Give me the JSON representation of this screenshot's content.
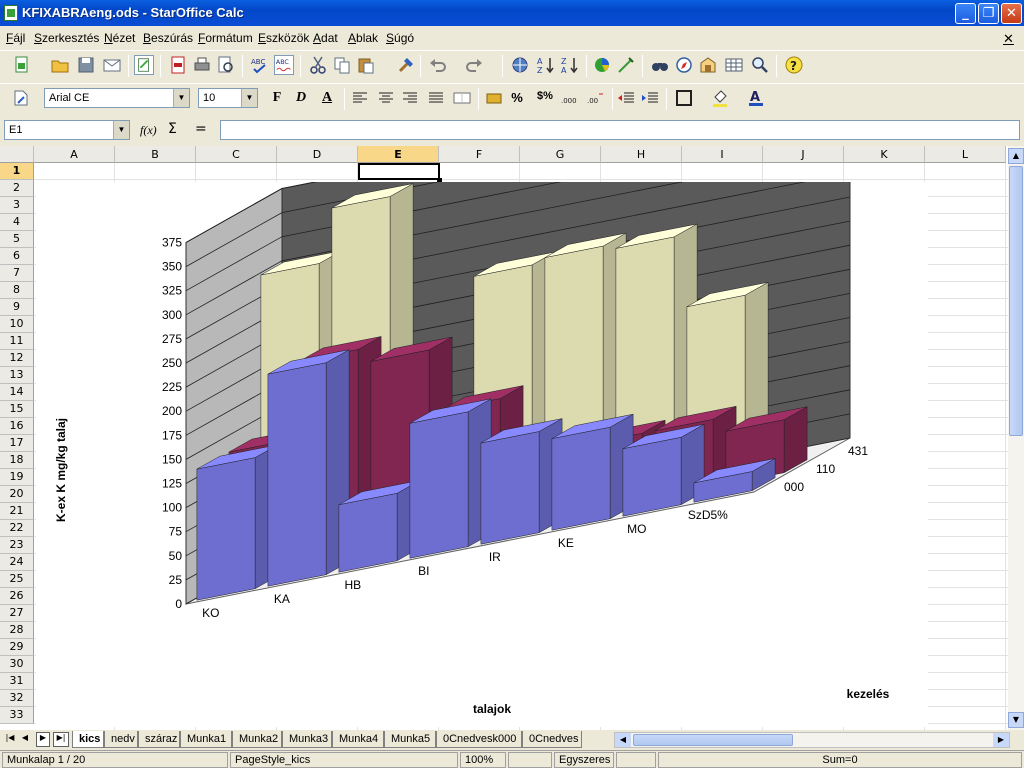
{
  "window": {
    "title": "KFIXABRAeng.ods - StarOffice Calc",
    "min_label": "_",
    "max_label": "❐",
    "close_label": "✕"
  },
  "menus": [
    "Fájl",
    "Szerkesztés",
    "Nézet",
    "Beszúrás",
    "Formátum",
    "Eszközök",
    "Adat",
    "Ablak",
    "Súgó"
  ],
  "menu_close": "✕",
  "format": {
    "font_name": "Arial CE",
    "font_size": "10",
    "bold": "F",
    "italic": "D",
    "underline": "A",
    "percent": "%",
    "currency": "$%"
  },
  "formula_bar": {
    "cell_ref": "E1",
    "fx": "f(x)",
    "sum": "Σ",
    "equals": "=",
    "content": ""
  },
  "columns": [
    "A",
    "B",
    "C",
    "D",
    "E",
    "F",
    "G",
    "H",
    "I",
    "J",
    "K",
    "L"
  ],
  "rows": [
    "1",
    "2",
    "3",
    "4",
    "5",
    "6",
    "7",
    "8",
    "9",
    "10",
    "11",
    "12",
    "13",
    "14",
    "15",
    "16",
    "17",
    "18",
    "19",
    "20",
    "21",
    "22",
    "23",
    "24",
    "25",
    "26",
    "27",
    "28",
    "29",
    "30",
    "31",
    "32",
    "33"
  ],
  "sheet_tabs": [
    "kics",
    "nedv",
    "száraz",
    "Munka1",
    "Munka2",
    "Munka3",
    "Munka4",
    "Munka5",
    "0Cnedvesk000",
    "0Cnedves"
  ],
  "status": {
    "page": "Munkalap 1 / 20",
    "style": "PageStyle_kics",
    "zoom": "100%",
    "mode": "Egyszeres",
    "sum": "Sum=0"
  },
  "chart_data": {
    "type": "bar",
    "subtype": "3d-deep",
    "categories": [
      "KO",
      "KA",
      "HB",
      "BI",
      "IR",
      "KE",
      "MO",
      "SzD5%"
    ],
    "series": [
      {
        "name": "000",
        "values": [
          136,
          220,
          70,
          140,
          105,
          95,
          70,
          20
        ],
        "color": "#7a7ae8"
      },
      {
        "name": "110",
        "values": [
          135,
          215,
          200,
          135,
          75,
          70,
          70,
          55
        ],
        "color": "#8e2a5a"
      },
      {
        "name": "431",
        "values": [
          300,
          355,
          110,
          255,
          260,
          255,
          180,
          0
        ],
        "color": "#f4f2c2"
      }
    ],
    "yticks": [
      "0",
      "25",
      "50",
      "75",
      "100",
      "125",
      "150",
      "175",
      "200",
      "225",
      "250",
      "275",
      "300",
      "325",
      "350",
      "375"
    ],
    "ylim": [
      0,
      375
    ],
    "ylabel": "K-ex  K mg/kg talaj",
    "xlabel": "talajok",
    "zlabel": "kezelés",
    "depth_labels": [
      "000",
      "110",
      "431"
    ],
    "grid": true
  }
}
